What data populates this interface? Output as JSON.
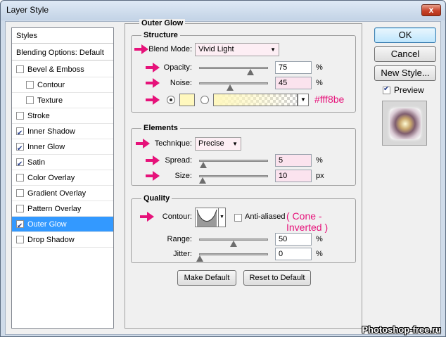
{
  "window": {
    "title": "Layer Style",
    "close_glyph": "x"
  },
  "styles_panel": {
    "header": "Styles",
    "blending_options": "Blending Options: Default",
    "items": [
      {
        "label": "Bevel & Emboss",
        "checked": false,
        "sub": false,
        "active": false
      },
      {
        "label": "Contour",
        "checked": false,
        "sub": true,
        "active": false
      },
      {
        "label": "Texture",
        "checked": false,
        "sub": true,
        "active": false
      },
      {
        "label": "Stroke",
        "checked": false,
        "sub": false,
        "active": false
      },
      {
        "label": "Inner Shadow",
        "checked": true,
        "sub": false,
        "active": false
      },
      {
        "label": "Inner Glow",
        "checked": true,
        "sub": false,
        "active": false
      },
      {
        "label": "Satin",
        "checked": true,
        "sub": false,
        "active": false
      },
      {
        "label": "Color Overlay",
        "checked": false,
        "sub": false,
        "active": false
      },
      {
        "label": "Gradient Overlay",
        "checked": false,
        "sub": false,
        "active": false
      },
      {
        "label": "Pattern Overlay",
        "checked": false,
        "sub": false,
        "active": false
      },
      {
        "label": "Outer Glow",
        "checked": true,
        "sub": false,
        "active": true
      },
      {
        "label": "Drop Shadow",
        "checked": false,
        "sub": false,
        "active": false
      }
    ]
  },
  "outer_glow": {
    "title": "Outer Glow",
    "structure": {
      "title": "Structure",
      "blend_mode_label": "Blend Mode:",
      "blend_mode_value": "Vivid Light",
      "opacity_label": "Opacity:",
      "opacity_value": "75",
      "opacity_level": 0.75,
      "noise_label": "Noise:",
      "noise_value": "45",
      "noise_level": 0.45,
      "color_hex": "#fff8be",
      "color_annotation": "#fff8be",
      "percent": "%"
    },
    "elements": {
      "title": "Elements",
      "technique_label": "Technique:",
      "technique_value": "Precise",
      "spread_label": "Spread:",
      "spread_value": "5",
      "spread_level": 0.05,
      "size_label": "Size:",
      "size_value": "10",
      "size_level": 0.04,
      "percent": "%",
      "px": "px"
    },
    "quality": {
      "title": "Quality",
      "contour_label": "Contour:",
      "anti_aliased_label": "Anti-aliased",
      "contour_annotation": "( Cone - Inverted )",
      "range_label": "Range:",
      "range_value": "50",
      "range_level": 0.5,
      "jitter_label": "Jitter:",
      "jitter_value": "0",
      "jitter_level": 0.0,
      "percent": "%"
    },
    "make_default": "Make Default",
    "reset_default": "Reset to Default"
  },
  "buttons": {
    "ok": "OK",
    "cancel": "Cancel",
    "new_style": "New Style..."
  },
  "preview": {
    "label": "Preview",
    "checked": true
  },
  "watermark": "Photoshop-free.ru",
  "colors": {
    "accent_arrow": "#e6127a",
    "selection": "#3399ff",
    "glow": "#fff8be"
  }
}
